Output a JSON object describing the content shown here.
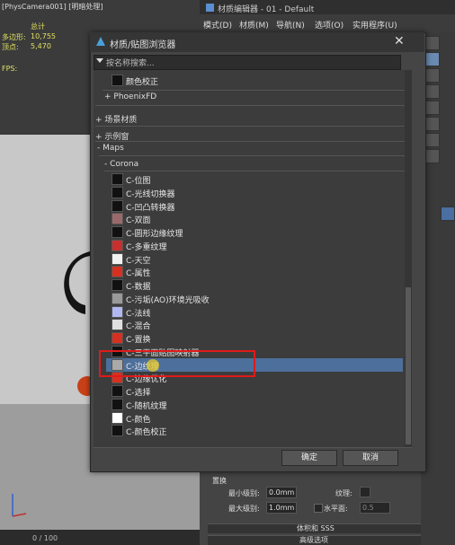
{
  "viewport": {
    "title": "[PhysCamera001] [明暗处理]",
    "stats_total": "总计",
    "poly_label": "多边形:",
    "poly_value": "10,755",
    "vert_label": "顶点:",
    "vert_value": "5,470",
    "fps_label": "FPS:",
    "timeline": "0 / 100"
  },
  "material_editor": {
    "title": "材质编辑器 - 01 - Default",
    "menus": [
      "模式(D)",
      "材质(M)",
      "导航(N)",
      "选项(O)",
      "实用程序(U)"
    ],
    "params": {
      "header": "置换",
      "min_level_label": "最小级别:",
      "min_level_value": "0.0mm",
      "max_level_label": "最大级别:",
      "max_level_value": "1.0mm",
      "texture_label": "纹理:",
      "horizon_label": "水平面:",
      "horizon_value": "0.5",
      "rollout1": "体积和 SSS",
      "rollout2": "高级选项"
    }
  },
  "dialog": {
    "title": "材质/贴图浏览器",
    "search_placeholder": "按名称搜索...",
    "top_item": "颜色校正",
    "groups": [
      "+ PhoenixFD",
      "+ 场景材质",
      "+ 示例窗",
      "- Maps",
      "- Corona"
    ],
    "items": [
      {
        "label": "C-位图",
        "color": "#111111"
      },
      {
        "label": "C-光线切换器",
        "color": "#111111"
      },
      {
        "label": "C-凹凸转换器",
        "color": "#111111"
      },
      {
        "label": "C-双面",
        "color": "#9a6a6a"
      },
      {
        "label": "C-圆形边缘纹理",
        "color": "#111111"
      },
      {
        "label": "C-多重纹理",
        "color": "#c83030"
      },
      {
        "label": "C-天空",
        "color": "#f2f2f2"
      },
      {
        "label": "C-属性",
        "color": "#d83020"
      },
      {
        "label": "C-数据",
        "color": "#111111"
      },
      {
        "label": "C-污垢(AO)环境光吸收",
        "color": "#9a9a9a"
      },
      {
        "label": "C-法线",
        "color": "#b0b8f0"
      },
      {
        "label": "C-混合",
        "color": "#e0e0e0"
      },
      {
        "label": "C-置换",
        "color": "#d83020"
      },
      {
        "label": "C-三平面贴图映射器",
        "color": "#111111"
      },
      {
        "label": "C-边纹理",
        "color": "#aaaaaa"
      },
      {
        "label": "C-边缘优化",
        "color": "#d83020"
      },
      {
        "label": "C-选择",
        "color": "#111111"
      },
      {
        "label": "C-随机纹理",
        "color": "#111111"
      },
      {
        "label": "C-颜色",
        "color": "#ffffff"
      },
      {
        "label": "C-颜色校正",
        "color": "#111111"
      }
    ],
    "ok_label": "确定",
    "cancel_label": "取消",
    "selected_index": 14,
    "accent": "#4d6f9b",
    "highlight_box_color": "#e01a1a"
  }
}
